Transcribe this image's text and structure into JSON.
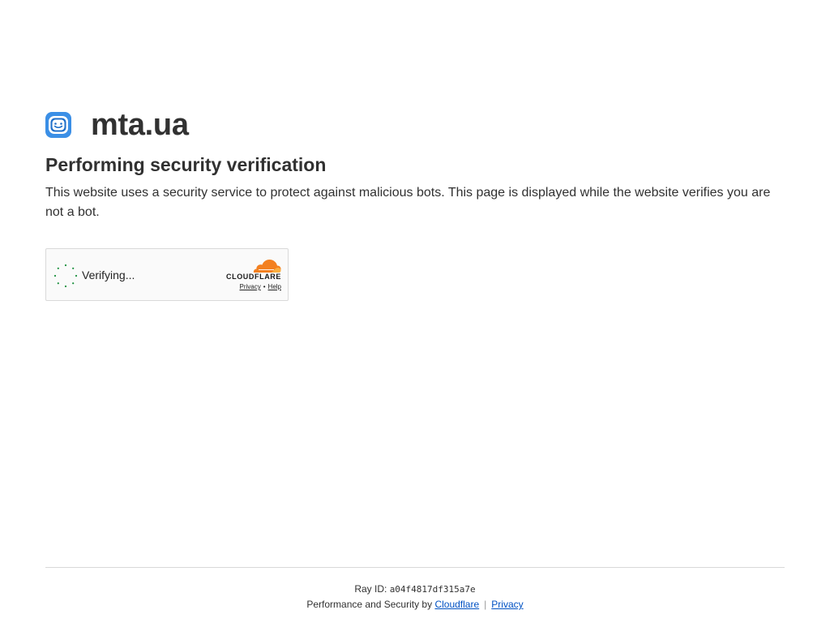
{
  "site": {
    "name": "mta.ua",
    "icon": "smiley-face-icon"
  },
  "heading": "Performing security verification",
  "description": "This website uses a security service to protect against malicious bots. This page is displayed while the website verifies you are not a bot.",
  "widget": {
    "status": "Verifying...",
    "brand": "CLOUDFLARE",
    "privacy_link": "Privacy",
    "separator": "•",
    "help_link": "Help",
    "brand_color": "#f38020"
  },
  "footer": {
    "ray_label": "Ray ID:",
    "ray_id": "a04f4817df315a7e",
    "perf_text": "Performance and Security by",
    "cloudflare_link": "Cloudflare",
    "separator": "|",
    "privacy_link": "Privacy",
    "link_color": "#0051c3"
  }
}
